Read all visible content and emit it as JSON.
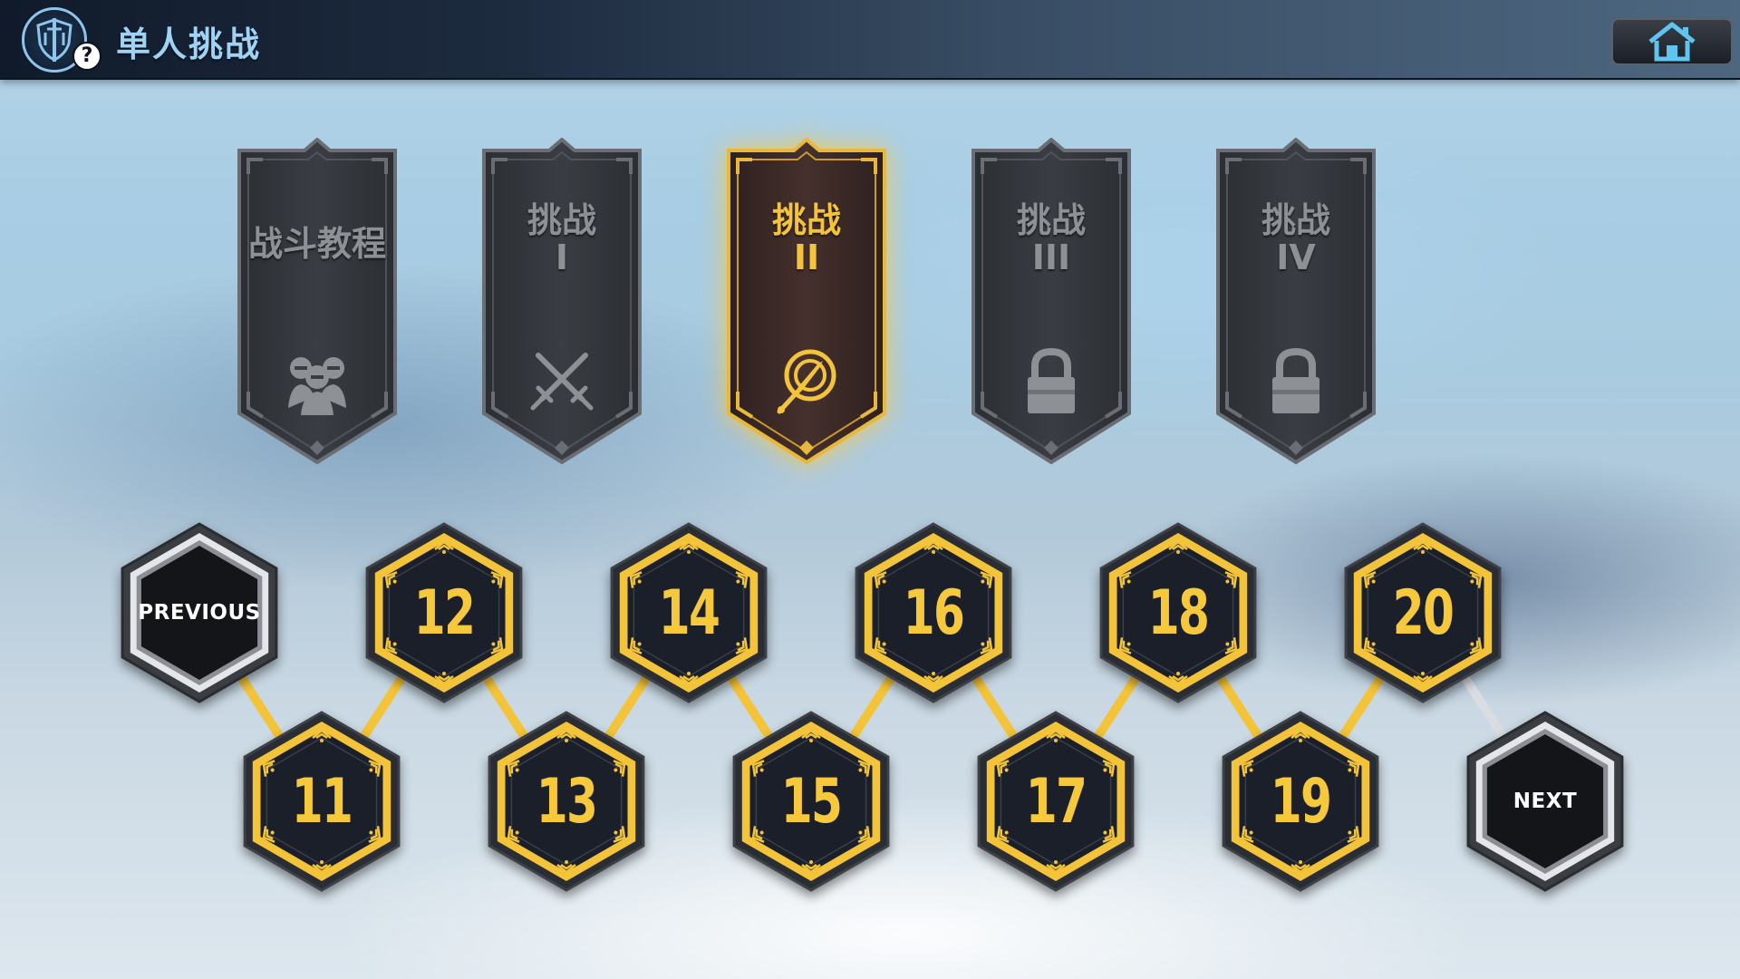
{
  "header": {
    "title": "单人挑战",
    "help_badge": "?",
    "logo_icon": "shield-sword-icon",
    "home_icon": "home-icon"
  },
  "banners": [
    {
      "title": "战斗教程",
      "numeral": "",
      "icon": "knights-group-icon",
      "state": "normal"
    },
    {
      "title": "挑战",
      "numeral": "I",
      "icon": "crossed-swords-icon",
      "state": "normal"
    },
    {
      "title": "挑战",
      "numeral": "II",
      "icon": "spear-target-icon",
      "state": "selected"
    },
    {
      "title": "挑战",
      "numeral": "III",
      "icon": "lock-icon",
      "state": "locked"
    },
    {
      "title": "挑战",
      "numeral": "IV",
      "icon": "lock-icon",
      "state": "locked"
    }
  ],
  "navigation": {
    "previous_label": "PREVIOUS",
    "next_label": "NEXT"
  },
  "levels": [
    {
      "number": "11"
    },
    {
      "number": "12"
    },
    {
      "number": "13"
    },
    {
      "number": "14"
    },
    {
      "number": "15"
    },
    {
      "number": "16"
    },
    {
      "number": "17"
    },
    {
      "number": "18"
    },
    {
      "number": "19"
    },
    {
      "number": "20"
    }
  ],
  "colors": {
    "accent_gold": "#f3c43a",
    "title_blue": "#9fd3f5",
    "locked_gray": "#8d9094",
    "hex_fill": "#1a1f2a"
  }
}
